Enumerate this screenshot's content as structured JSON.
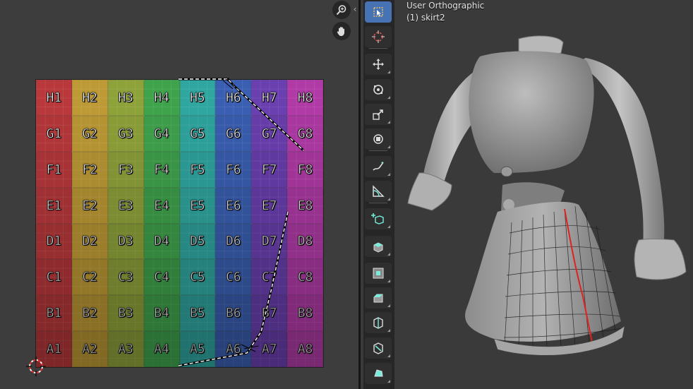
{
  "uv_editor": {
    "rows": [
      "H",
      "G",
      "F",
      "E",
      "D",
      "C",
      "B",
      "A"
    ],
    "columns": [
      "1",
      "2",
      "3",
      "4",
      "5",
      "6",
      "7",
      "8"
    ],
    "column_colors": [
      "#b8383b",
      "#bd9a35",
      "#8ea23a",
      "#3fa34c",
      "#2fa6a0",
      "#3a5fb2",
      "#6a3fb0",
      "#b03aa6"
    ],
    "zoom_icon": "magnifier-zoom-icon",
    "pan_icon": "hand-pan-icon",
    "cursor_icon": "2d-cursor-icon"
  },
  "viewport": {
    "view_name": "User Orthographic",
    "object_name": "(1) skirt2"
  },
  "toolbar": {
    "tools": [
      {
        "name": "select-box-icon",
        "active": true
      },
      {
        "name": "cursor-icon",
        "active": false
      },
      {
        "name": "move-icon",
        "active": false
      },
      {
        "name": "rotate-icon",
        "active": false
      },
      {
        "name": "scale-icon",
        "active": false
      },
      {
        "name": "transform-icon",
        "active": false
      },
      {
        "name": "annotate-icon",
        "active": false
      },
      {
        "name": "measure-icon",
        "active": false
      },
      {
        "name": "add-cube-icon",
        "active": false
      },
      {
        "name": "extrude-icon",
        "active": false
      },
      {
        "name": "inset-icon",
        "active": false
      },
      {
        "name": "bevel-icon",
        "active": false
      },
      {
        "name": "loop-cut-icon",
        "active": false
      },
      {
        "name": "knife-icon",
        "active": false
      },
      {
        "name": "poly-build-icon",
        "active": false
      }
    ]
  }
}
